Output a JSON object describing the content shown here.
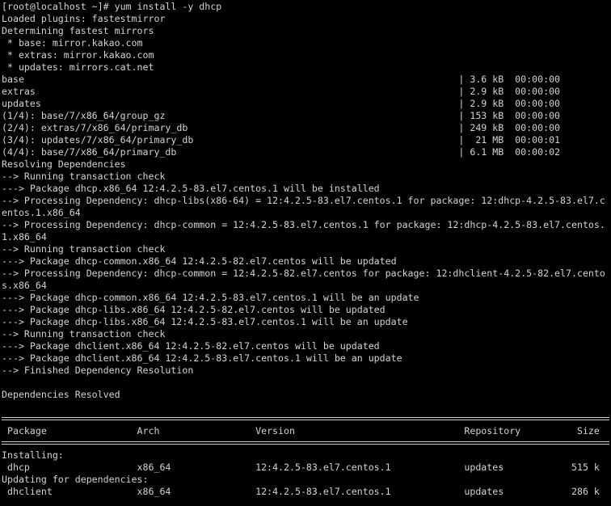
{
  "terminal": {
    "lines": [
      "[root@localhost ~]# yum install -y dhcp",
      "Loaded plugins: fastestmirror",
      "Determining fastest mirrors",
      " * base: mirror.kakao.com",
      " * extras: mirror.kakao.com",
      " * updates: mirrors.cat.net",
      "base                                                                             | 3.6 kB  00:00:00",
      "extras                                                                           | 2.9 kB  00:00:00",
      "updates                                                                          | 2.9 kB  00:00:00",
      "(1/4): base/7/x86_64/group_gz                                                    | 153 kB  00:00:00",
      "(2/4): extras/7/x86_64/primary_db                                                | 249 kB  00:00:00",
      "(3/4): updates/7/x86_64/primary_db                                               |  21 MB  00:00:01",
      "(4/4): base/7/x86_64/primary_db                                                  | 6.1 MB  00:00:02",
      "Resolving Dependencies",
      "--> Running transaction check",
      "---> Package dhcp.x86_64 12:4.2.5-83.el7.centos.1 will be installed",
      "--> Processing Dependency: dhcp-libs(x86-64) = 12:4.2.5-83.el7.centos.1 for package: 12:dhcp-4.2.5-83.el7.c",
      "entos.1.x86_64",
      "--> Processing Dependency: dhcp-common = 12:4.2.5-83.el7.centos.1 for package: 12:dhcp-4.2.5-83.el7.centos.",
      "1.x86_64",
      "--> Running transaction check",
      "---> Package dhcp-common.x86_64 12:4.2.5-82.el7.centos will be updated",
      "--> Processing Dependency: dhcp-common = 12:4.2.5-82.el7.centos for package: 12:dhclient-4.2.5-82.el7.cento",
      "s.x86_64",
      "---> Package dhcp-common.x86_64 12:4.2.5-83.el7.centos.1 will be an update",
      "---> Package dhcp-libs.x86_64 12:4.2.5-82.el7.centos will be updated",
      "---> Package dhcp-libs.x86_64 12:4.2.5-83.el7.centos.1 will be an update",
      "--> Running transaction check",
      "---> Package dhclient.x86_64 12:4.2.5-82.el7.centos will be updated",
      "---> Package dhclient.x86_64 12:4.2.5-83.el7.centos.1 will be an update",
      "--> Finished Dependency Resolution",
      "",
      "Dependencies Resolved",
      ""
    ],
    "table_header": " Package                Arch                 Version                              Repository          Size",
    "installing_label": "Installing:",
    "installing_row": " dhcp                   x86_64               12:4.2.5-83.el7.centos.1             updates            515 k",
    "deps_label": "Updating for dependencies:",
    "deps_row": " dhclient               x86_64               12:4.2.5-83.el7.centos.1             updates            286 k"
  },
  "colors": {
    "background": "#000000",
    "foreground": "#d3d3d3"
  }
}
